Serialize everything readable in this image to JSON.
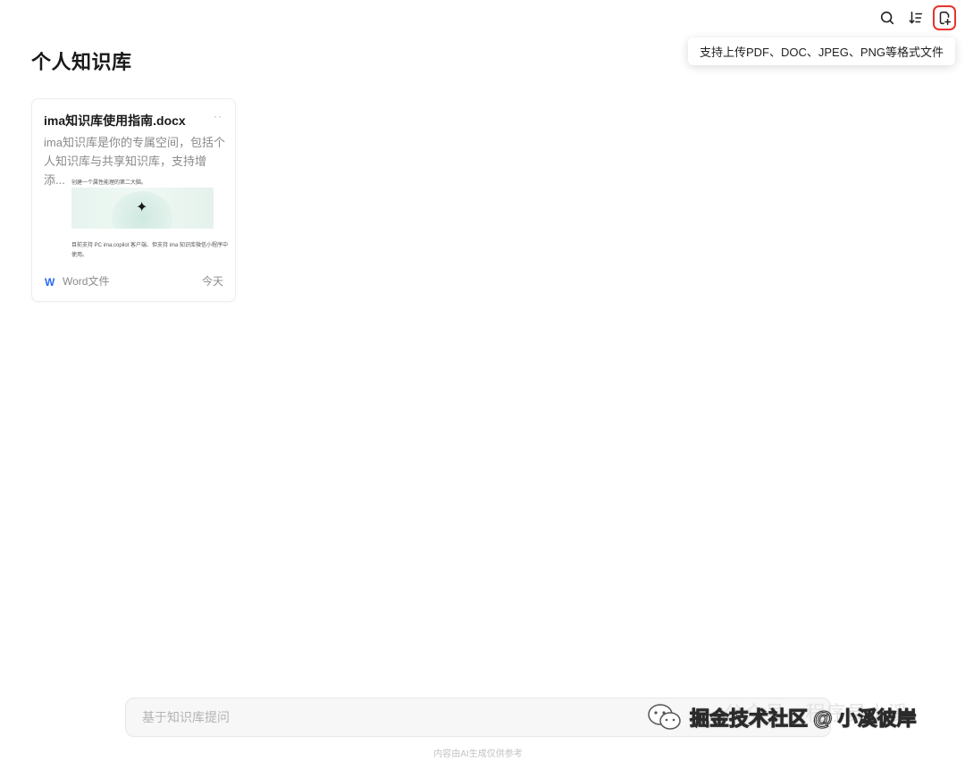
{
  "toolbar": {
    "tooltip": "支持上传PDF、DOC、JPEG、PNG等格式文件",
    "icons": [
      "search-icon",
      "sort-icon",
      "upload-file-icon"
    ],
    "highlight_color": "#e8332d"
  },
  "page": {
    "title": "个人知识库"
  },
  "card": {
    "title": "ima知识库使用指南.docx",
    "more": "··",
    "description": "ima知识库是你的专属空间，包括个人知识库与共享知识库，支持增添...",
    "preview_line_1": "创建一个属性能理的第二大脑。",
    "preview_line_2": "目前支持 PC ima.copilot 客户端、但支持 ima 知识库微信小程序中",
    "preview_line_3": "使用。",
    "file_icon": "W",
    "file_type": "Word文件",
    "date": "今天",
    "file_icon_color": "#2a6af0"
  },
  "ask": {
    "placeholder": "基于知识库提问"
  },
  "disclaimer": "内容由AI生成仅供参考",
  "watermark": {
    "back_text": "公众号 · 程序员小溪",
    "front_text": "掘金技术社区 @ 小溪彼岸"
  }
}
